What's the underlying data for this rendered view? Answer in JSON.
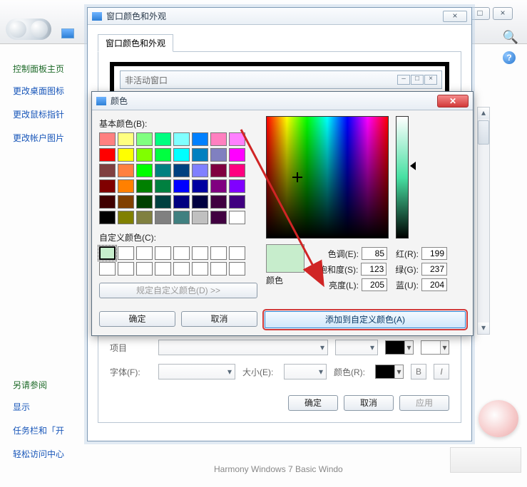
{
  "bg": {
    "sys_min": "—",
    "sys_max": "□",
    "sys_close": "×",
    "sidebar_title": "控制面板主页",
    "links": [
      "更改桌面图标",
      "更改鼠标指针",
      "更改帐户图片"
    ],
    "see_also": "另请参阅",
    "links2": [
      "显示",
      "任务栏和「开",
      "轻松访问中心"
    ],
    "footer": "Harmony      Windows 7 Basic      Windo"
  },
  "winA": {
    "title": "窗口颜色和外观",
    "tab": "窗口颜色和外观",
    "preview_title": "非活动窗口",
    "item_label": "项目",
    "font_label": "字体(F):",
    "size_label": "大小(E):",
    "color_label": "颜色(R):",
    "btn_ok": "确定",
    "btn_cancel": "取消",
    "btn_apply": "应用"
  },
  "dlg": {
    "title": "颜色",
    "basic_label": "基本颜色(B):",
    "custom_label": "自定义颜色(C):",
    "define_btn": "规定自定义颜色(D) >>",
    "ok": "确定",
    "cancel": "取消",
    "solid_label": "颜色",
    "hue_label": "色调(E):",
    "sat_label": "饱和度(S):",
    "lum_label": "亮度(L):",
    "r_label": "红(R):",
    "g_label": "绿(G):",
    "b_label": "蓝(U):",
    "hue": "85",
    "sat": "123",
    "lum": "205",
    "r": "199",
    "g": "237",
    "b": "204",
    "add_btn": "添加到自定义颜色(A)",
    "solid_color": "#c7edcc",
    "basic_colors": [
      "#ff8080",
      "#ffff80",
      "#80ff80",
      "#00ff80",
      "#80ffff",
      "#0080ff",
      "#ff80c0",
      "#ff80ff",
      "#ff0000",
      "#ffff00",
      "#80ff00",
      "#00ff40",
      "#00ffff",
      "#0080c0",
      "#8080c0",
      "#ff00ff",
      "#804040",
      "#ff8040",
      "#00ff00",
      "#008080",
      "#004080",
      "#8080ff",
      "#800040",
      "#ff0080",
      "#800000",
      "#ff8000",
      "#008000",
      "#008040",
      "#0000ff",
      "#0000a0",
      "#800080",
      "#8000ff",
      "#400000",
      "#804000",
      "#004000",
      "#004040",
      "#000080",
      "#000040",
      "#400040",
      "#400080",
      "#000000",
      "#808000",
      "#808040",
      "#808080",
      "#408080",
      "#c0c0c0",
      "#400040",
      "#ffffff"
    ],
    "custom_swatch0": "#c7edcc"
  }
}
